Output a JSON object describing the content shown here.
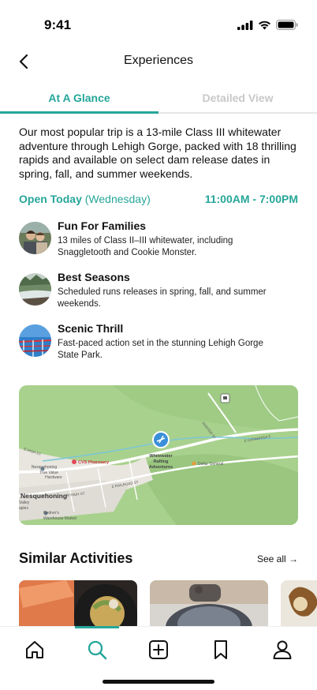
{
  "status": {
    "time": "9:41"
  },
  "nav": {
    "title": "Experiences"
  },
  "tabs": [
    {
      "label": "At A Glance",
      "active": true
    },
    {
      "label": "Detailed View",
      "active": false
    }
  ],
  "intro": "Our most popular trip is a 13-mile Class III whitewater adventure through Lehigh Gorge, packed with 18 thrilling rapids and available on select dam release dates in spring, fall, and summer weekends.",
  "hours": {
    "open_label": "Open Today",
    "day": "(Wednesday)",
    "time_range": "11:00AM - 7:00PM"
  },
  "features": [
    {
      "title": "Fun For Families",
      "description": "13 miles of Class II–III whitewater, including Snaggletooth and Cookie Monster."
    },
    {
      "title": "Best Seasons",
      "description": "Scheduled runs releases in spring, fall, and summer weekends."
    },
    {
      "title": "Scenic Thrill",
      "description": "Fast-paced action set in the stunning Lehigh Gorge State Park."
    }
  ],
  "map": {
    "town": "Nesquehoning",
    "poi_main": "Whitewater Rafting Adventures",
    "poi_main_line1": "Whitewater",
    "poi_main_line2": "Rafting",
    "poi_main_line3": "Adventures",
    "pharmacy": "CVS Pharmacy",
    "hardware_line1": "Nesquehoning",
    "hardware_line2": "True Value",
    "hardware_line3": "Hardware",
    "dollar": "Dollar General",
    "market_line1": "Redner's",
    "market_line2": "Warehouse Market",
    "valley_line1": "Valley",
    "valley_line2": "aplex",
    "road_1": "E CATAWISSA S",
    "road_2": "HUNTER ST",
    "road_3": "E RAILROAD ST",
    "road_4": "W HIGH ST",
    "road_5": "E HIGH ST",
    "road_6": "E CATAWISSA ST"
  },
  "similar": {
    "title": "Similar Activities",
    "see_all": "See all →"
  },
  "colors": {
    "accent": "#26a69a",
    "map_green": "#a8d08d",
    "map_dark": "#8fbf72"
  }
}
